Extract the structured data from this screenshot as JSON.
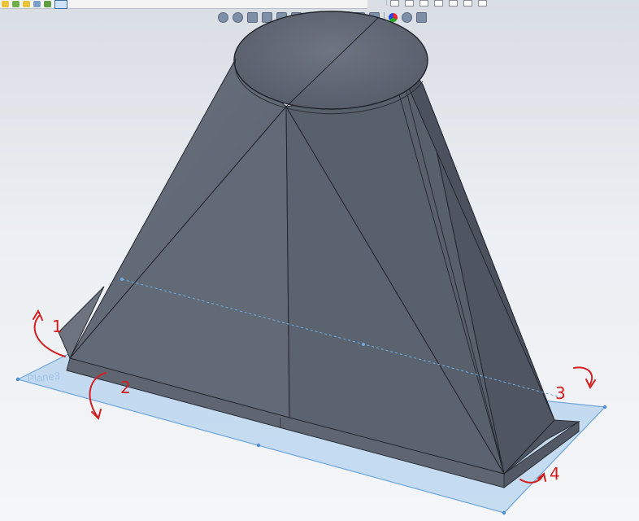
{
  "toolbar": {
    "icons": [
      "new-icon",
      "open-icon",
      "save-icon",
      "options-icon",
      "select-icon"
    ]
  },
  "window_controls": [
    "help-icon",
    "minimize-icon",
    "restore-icon",
    "close-icon"
  ],
  "heads_up_toolbar": {
    "icons": [
      "zoom-to-fit-icon",
      "zoom-area-icon",
      "previous-view-icon",
      "section-view-icon",
      "view-orientation-icon",
      "display-style-icon",
      "shaded-icon",
      "hide-show-icon",
      "edit-appearance-icon",
      "apply-scene-icon",
      "view-settings-icon"
    ]
  },
  "model": {
    "plane_label": "Plane3",
    "plane_color": "#8fbce8",
    "body_color": "#5d6573",
    "annotations": [
      "1",
      "2",
      "3",
      "4"
    ],
    "annotation_color": "#d21e1e"
  }
}
